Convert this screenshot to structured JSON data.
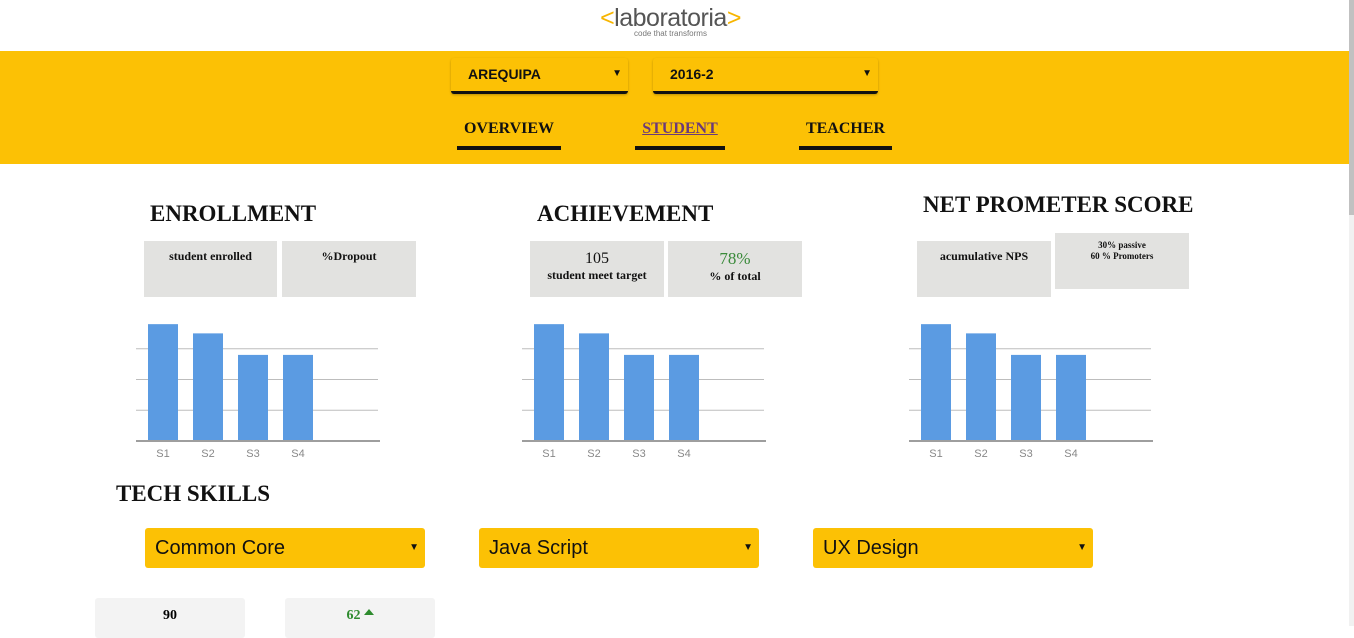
{
  "brand": {
    "left_bracket": "<",
    "name": "laboratoria",
    "right_bracket": ">",
    "tagline": "code that transforms"
  },
  "filters": {
    "city": "AREQUIPA",
    "term": "2016-2"
  },
  "tabs": [
    {
      "label": "OVERVIEW"
    },
    {
      "label": "STUDENT",
      "active": true
    },
    {
      "label": "TEACHER"
    }
  ],
  "sections": {
    "enrollment": {
      "title": "ENROLLMENT",
      "box1": {
        "label": "student enrolled"
      },
      "box2": {
        "label": "%Dropout"
      }
    },
    "achievement": {
      "title": "ACHIEVEMENT",
      "box1": {
        "value": "105",
        "label": "student meet target"
      },
      "box2": {
        "value": "78%",
        "label": "% of total"
      }
    },
    "nps": {
      "title": "NET PROMETER SCORE",
      "box1": {
        "label": "acumulative NPS"
      },
      "box2": {
        "line1": "30% passive",
        "line2": "60 % Promoters"
      }
    }
  },
  "chart_data": [
    {
      "type": "bar",
      "categories": [
        "S1",
        "S2",
        "S3",
        "S4"
      ],
      "values": [
        3.8,
        3.5,
        2.8,
        2.8
      ],
      "ylim": [
        0,
        4
      ],
      "grid": true,
      "color": "#5b9be2"
    },
    {
      "type": "bar",
      "categories": [
        "S1",
        "S2",
        "S3",
        "S4"
      ],
      "values": [
        3.8,
        3.5,
        2.8,
        2.8
      ],
      "ylim": [
        0,
        4
      ],
      "grid": true,
      "color": "#5b9be2"
    },
    {
      "type": "bar",
      "categories": [
        "S1",
        "S2",
        "S3",
        "S4"
      ],
      "values": [
        3.8,
        3.5,
        2.8,
        2.8
      ],
      "ylim": [
        0,
        4
      ],
      "grid": true,
      "color": "#5b9be2"
    }
  ],
  "tech_skills": {
    "title": "TECH SKILLS",
    "selects": [
      "Common Core",
      "Java Script",
      "UX Design"
    ],
    "scores": [
      {
        "value": "90"
      },
      {
        "value": "62",
        "trend": "up"
      }
    ]
  },
  "colors": {
    "accent": "#fcc105",
    "bar": "#5b9be2",
    "positive": "#2e8b2e"
  }
}
